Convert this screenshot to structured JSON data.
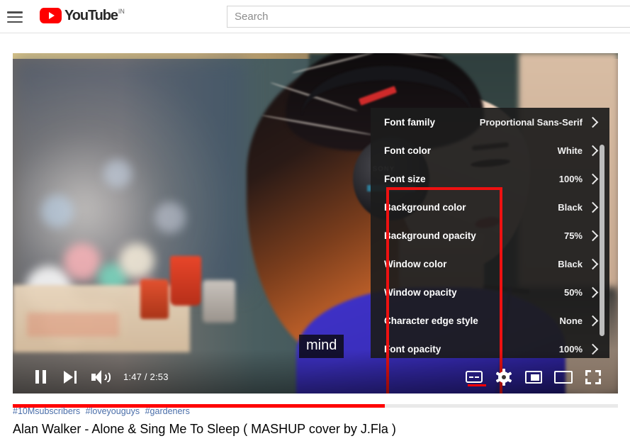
{
  "header": {
    "menu_icon": "hamburger-icon",
    "logo_text": "YouTube",
    "logo_country": "IN",
    "search_placeholder": "Search",
    "search_value": ""
  },
  "player": {
    "caption_text": "mind",
    "time_current": "1:47",
    "time_separator": "/",
    "time_total": "2:53",
    "time_display": "1:47 / 2:53",
    "progress_percent": 61.5,
    "controls": {
      "pause_label": "Pause",
      "next_label": "Next",
      "volume_label": "Mute",
      "subtitles_label": "Subtitles/CC",
      "settings_label": "Settings",
      "miniplayer_label": "Miniplayer",
      "theater_label": "Theater mode",
      "fullscreen_label": "Full screen"
    },
    "progress_color": "#ff0000"
  },
  "settings_menu": {
    "items": [
      {
        "label": "Font family",
        "value": "Proportional Sans-Serif"
      },
      {
        "label": "Font color",
        "value": "White"
      },
      {
        "label": "Font size",
        "value": "100%"
      },
      {
        "label": "Background color",
        "value": "Black"
      },
      {
        "label": "Background opacity",
        "value": "75%"
      },
      {
        "label": "Window color",
        "value": "Black"
      },
      {
        "label": "Window opacity",
        "value": "50%"
      },
      {
        "label": "Character edge style",
        "value": "None"
      },
      {
        "label": "Font opacity",
        "value": "100%"
      }
    ],
    "highlight_color": "#ee1111"
  },
  "meta": {
    "hashtags": [
      "#10Msubscribers",
      "#loveyouguys",
      "#gardeners"
    ],
    "title": "Alan Walker - Alone & Sing Me To Sleep ( MASHUP cover by J.Fla )",
    "hashtag_color": "#4a6ea9"
  }
}
